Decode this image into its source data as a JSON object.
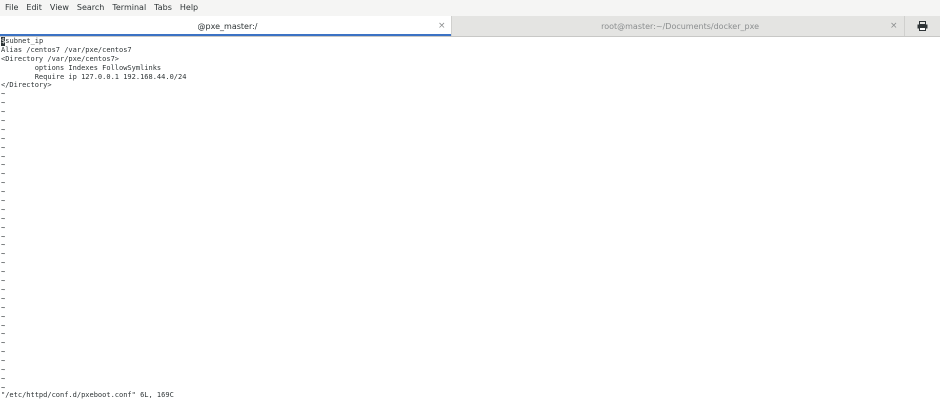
{
  "menu": [
    "File",
    "Edit",
    "View",
    "Search",
    "Terminal",
    "Tabs",
    "Help"
  ],
  "tabs": [
    {
      "title": "@pxe_master:/",
      "close": "×",
      "active": true
    },
    {
      "title": "root@master:~/Documents/docker_pxe",
      "close": "×",
      "active": false
    }
  ],
  "tab_menu_icon": "printer-icon",
  "editor": {
    "cursor_char": "$",
    "first_line_rest": "subnet_ip",
    "lines": [
      "Alias /centos7 /var/pxe/centos7",
      "<Directory /var/pxe/centos7>",
      "        options Indexes FollowSymlinks",
      "        Require ip 127.0.0.1 192.168.44.0/24",
      "</Directory>"
    ],
    "tilde": "~",
    "empty_line_count": 34,
    "status_line": "\"/etc/httpd/conf.d/pxeboot.conf\" 6L, 169C"
  }
}
